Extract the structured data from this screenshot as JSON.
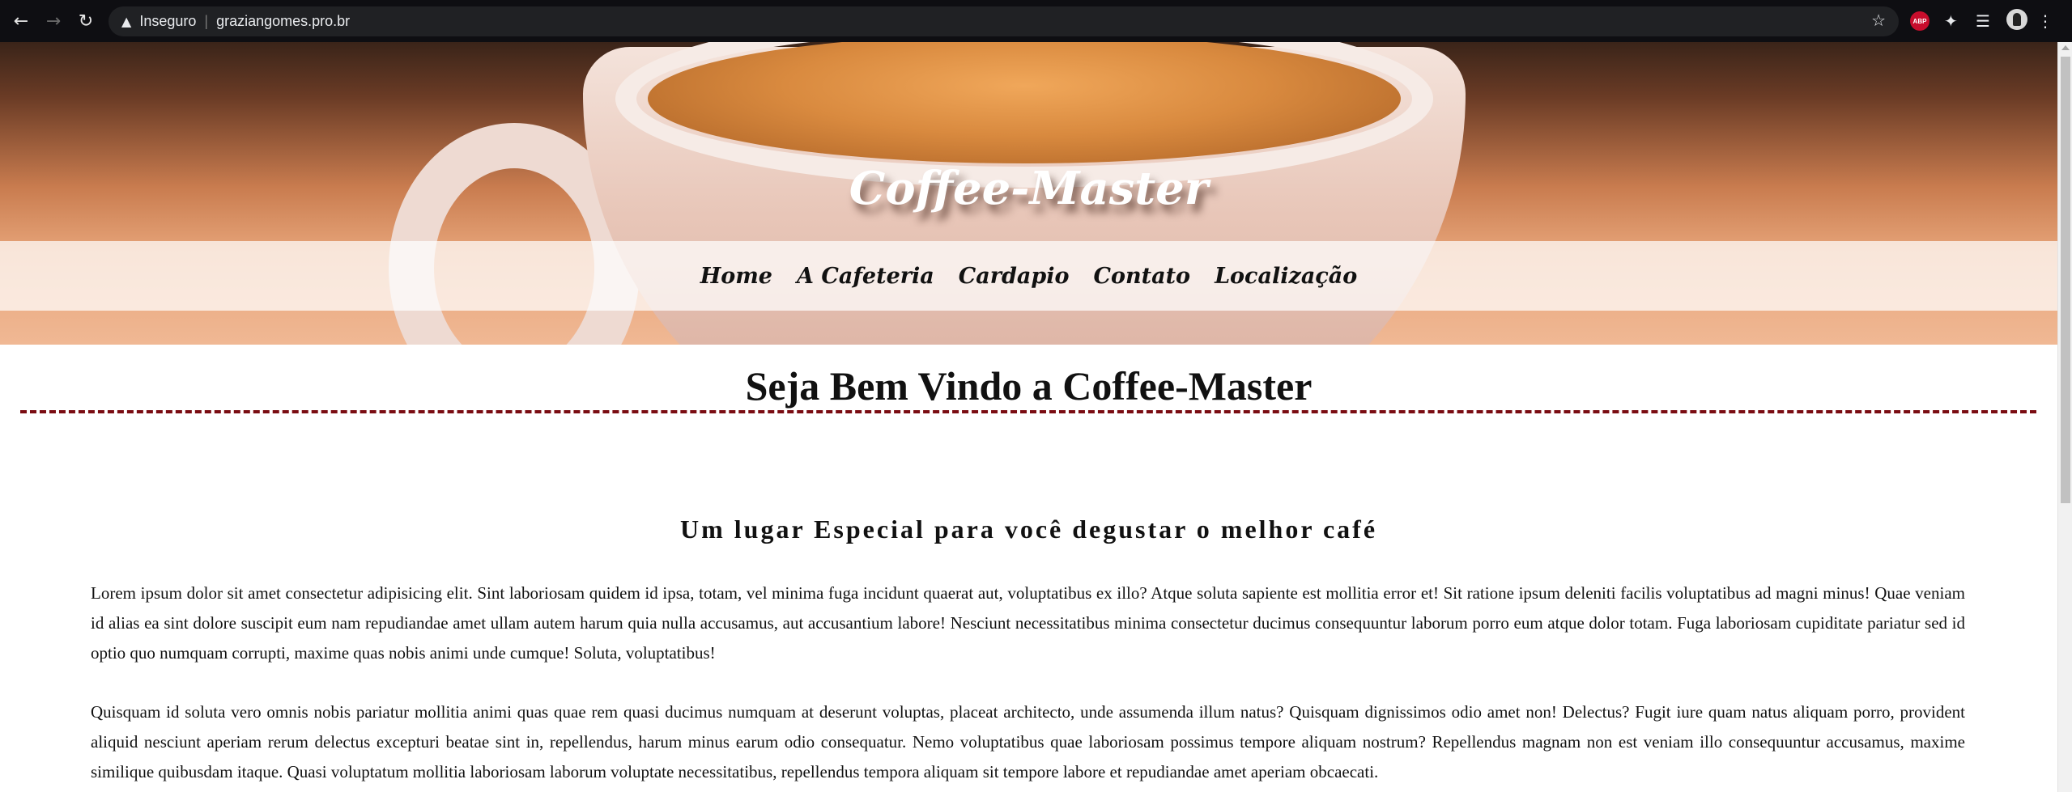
{
  "browser": {
    "security_label": "Inseguro",
    "url": "graziangomes.pro.br",
    "abp_label": "ABP"
  },
  "site": {
    "title": "Coffee-Master",
    "nav": [
      {
        "label": "Home"
      },
      {
        "label": "A Cafeteria"
      },
      {
        "label": "Cardapio"
      },
      {
        "label": "Contato"
      },
      {
        "label": "Localização"
      }
    ]
  },
  "main": {
    "heading": "Seja Bem Vindo a Coffee-Master",
    "subheading": "Um lugar Especial para você degustar o melhor café",
    "paragraphs": [
      "Lorem ipsum dolor sit amet consectetur adipisicing elit. Sint laboriosam quidem id ipsa, totam, vel minima fuga incidunt quaerat aut, voluptatibus ex illo? Atque soluta sapiente est mollitia error et! Sit ratione ipsum deleniti facilis voluptatibus ad magni minus! Quae veniam id alias ea sint dolore suscipit eum nam repudiandae amet ullam autem harum quia nulla accusamus, aut accusantium labore! Nesciunt necessitatibus minima consectetur ducimus consequuntur laborum porro eum atque dolor totam. Fuga laboriosam cupiditate pariatur sed id optio quo numquam corrupti, maxime quas nobis animi unde cumque! Soluta, voluptatibus!",
      "Quisquam id soluta vero omnis nobis pariatur mollitia animi quas quae rem quasi ducimus numquam at deserunt voluptas, placeat architecto, unde assumenda illum natus? Quisquam dignissimos odio amet non! Delectus? Fugit iure quam natus aliquam porro, provident aliquid nesciunt aperiam rerum delectus excepturi beatae sint in, repellendus, harum minus earum odio consequatur. Nemo voluptatibus quae laboriosam possimus tempore aliquam nostrum? Repellendus magnam non est veniam illo consequuntur accusamus, maxime similique quibusdam itaque. Quasi voluptatum mollitia laboriosam laborum voluptate necessitatibus, repellendus tempora aliquam sit tempore labore et repudiandae amet aperiam obcaecati."
    ]
  },
  "colors": {
    "divider": "#7a0c12",
    "chrome_bg": "#0e0e12"
  }
}
